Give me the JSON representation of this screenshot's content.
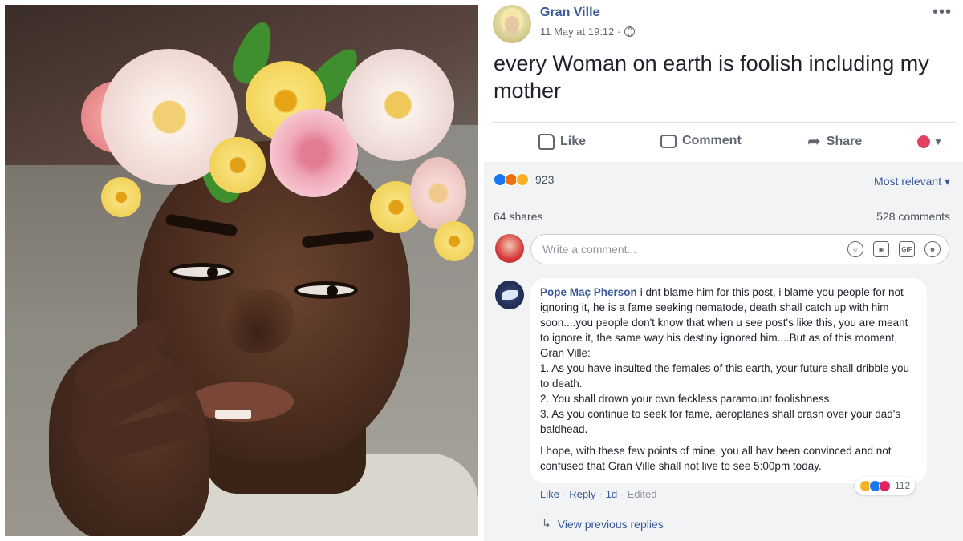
{
  "post": {
    "author": "Gran Ville",
    "timestamp": "11 May at 19:12 ·",
    "privacy_icon": "globe-icon",
    "more_label": "•••",
    "text": "every Woman on earth is foolish including my mother",
    "actions": {
      "like": "Like",
      "comment": "Comment",
      "share": "Share"
    },
    "reactions_count": "923",
    "reaction_types": [
      "like",
      "angry",
      "haha"
    ],
    "sort_label": "Most relevant ▾",
    "shares": "64 shares",
    "comments_count": "528 comments",
    "comment_placeholder": "Write a comment...",
    "composer_icons": [
      "emoji-icon",
      "camera-icon",
      "gif-icon",
      "sticker-icon"
    ],
    "gif_label": "GIF"
  },
  "comment": {
    "author": "Pope Maç Pherson",
    "intro": "i dnt blame him for this post, i blame you people for not ignoring it, he is a fame seeking nematode, death shall catch up with him soon....you people don't know that when u see post's like this, you are meant to ignore it, the same way his destiny ignored him....But as of this moment, Gran Ville:",
    "points": [
      "1. As you have insulted the females of this earth, your future shall dribble you to death.",
      "2. You shall drown your own feckless paramount foolishness.",
      "3. As you continue to seek for fame, aeroplanes shall crash over your dad's baldhead."
    ],
    "closing": "I hope, with these few points of mine, you all hav been convinced and not confused that Gran Ville shall not live to see 5:00pm today.",
    "reactions_count": "112",
    "like_label": "Like",
    "reply_label": "Reply",
    "age": "1d",
    "edited": "Edited",
    "sep": "·",
    "view_previous": "View previous replies"
  },
  "colors": {
    "link": "#385898",
    "meta": "#606770",
    "panel": "#f2f3f5"
  }
}
